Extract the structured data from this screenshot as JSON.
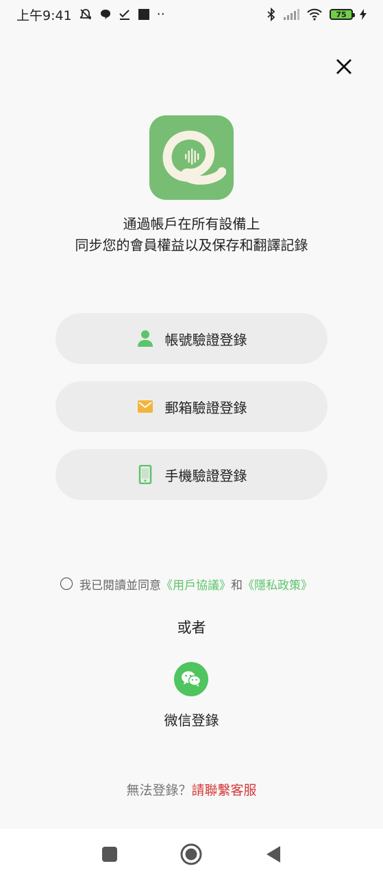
{
  "status_bar": {
    "time": "上午9:41",
    "dots": "··",
    "battery_level": "75",
    "icons": [
      "mute-icon",
      "chat-bubble-icon",
      "check-icon",
      "square-icon",
      "bluetooth-icon",
      "signal-icon",
      "wifi-icon",
      "battery-icon",
      "charging-icon"
    ]
  },
  "header": {
    "close_icon": "close-icon"
  },
  "app": {
    "logo_icon": "app-logo-icon",
    "brand_color": "#77bd73"
  },
  "intro": {
    "line1": "通過帳戶在所有設備上",
    "line2": "同步您的會員權益以及保存和翻譯記錄"
  },
  "login_options": [
    {
      "label": "帳號驗證登錄",
      "icon": "user-icon",
      "icon_color": "#5cc46a"
    },
    {
      "label": "郵箱驗證登錄",
      "icon": "mail-icon",
      "icon_color": "#f2b43a"
    },
    {
      "label": "手機驗證登錄",
      "icon": "phone-icon",
      "icon_color": "#5cc46a"
    }
  ],
  "agreement": {
    "prefix": "我已閱讀並同意",
    "user_agreement": "《用戶協議》",
    "and": "和",
    "privacy_policy": "《隱私政策》",
    "link_color": "#5cc46a",
    "checked": false
  },
  "alt_login": {
    "or_text": "或者",
    "wechat_label": "微信登錄",
    "wechat_color": "#4fc45f"
  },
  "help": {
    "prefix": "無法登錄？",
    "contact": "請聯繫客服",
    "contact_color": "#d43a3a"
  },
  "nav_bar": {
    "buttons": [
      "recents-icon",
      "home-icon",
      "back-icon"
    ]
  }
}
